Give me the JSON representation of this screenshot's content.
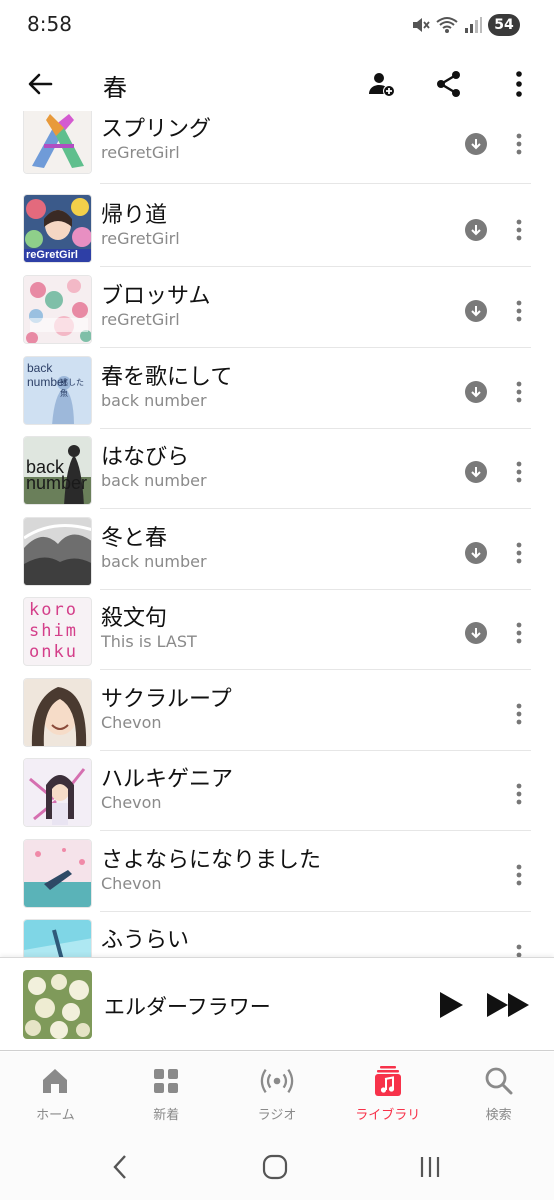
{
  "status": {
    "time": "8:58",
    "battery": "54"
  },
  "header": {
    "title": "春"
  },
  "songs": [
    {
      "title": "スプリング",
      "artist": "reGretGirl",
      "downloaded": true
    },
    {
      "title": "帰り道",
      "artist": "reGretGirl",
      "downloaded": true
    },
    {
      "title": "ブロッサム",
      "artist": "reGretGirl",
      "downloaded": true
    },
    {
      "title": "春を歌にして",
      "artist": "back number",
      "downloaded": true
    },
    {
      "title": "はなびら",
      "artist": "back number",
      "downloaded": true
    },
    {
      "title": "冬と春",
      "artist": "back number",
      "downloaded": true
    },
    {
      "title": "殺文句",
      "artist": "This is LAST",
      "downloaded": true
    },
    {
      "title": "サクラループ",
      "artist": "Chevon",
      "downloaded": false
    },
    {
      "title": "ハルキゲニア",
      "artist": "Chevon",
      "downloaded": false
    },
    {
      "title": "さよならになりました",
      "artist": "Chevon",
      "downloaded": false
    },
    {
      "title": "ふうらい",
      "artist": "",
      "downloaded": false
    }
  ],
  "art_text": {
    "regretgirl": "reGretGirl",
    "backnumber": "back number",
    "backnumber_sub": "逃した魚",
    "backnumber_logo_1": "back",
    "backnumber_logo_2": "number",
    "koroshi": [
      "koro",
      "shim",
      "onku"
    ]
  },
  "now_playing": {
    "title": "エルダーフラワー"
  },
  "nav": {
    "items": [
      {
        "label": "ホーム",
        "icon": "home-icon"
      },
      {
        "label": "新着",
        "icon": "grid-icon"
      },
      {
        "label": "ラジオ",
        "icon": "radio-icon"
      },
      {
        "label": "ライブラリ",
        "icon": "library-icon"
      },
      {
        "label": "検索",
        "icon": "search-icon"
      }
    ],
    "active_index": 3
  },
  "colors": {
    "accent": "#f7324a",
    "inactive": "#8a8a8a"
  }
}
